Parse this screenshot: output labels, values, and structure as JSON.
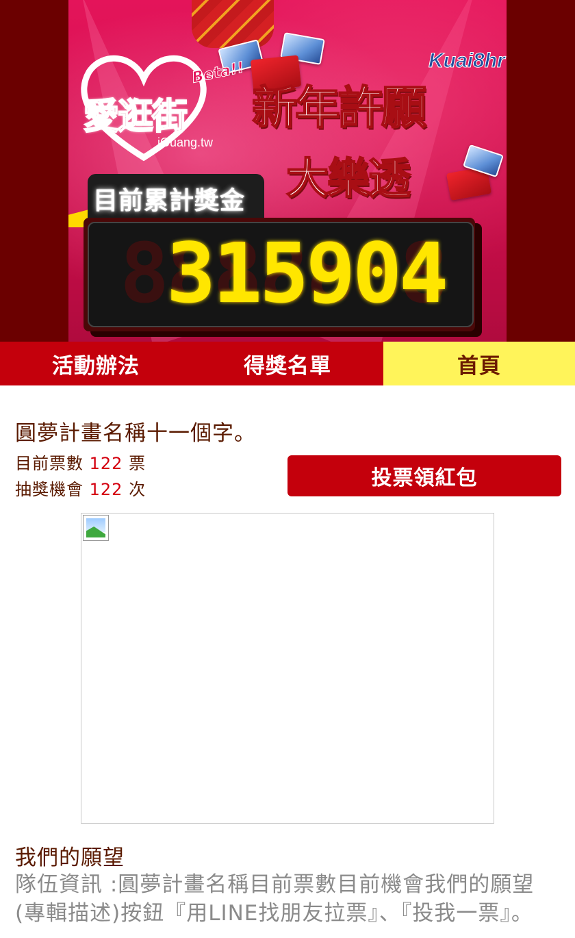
{
  "banner": {
    "logo_text": "愛逛街",
    "beta_label": "Beta!!",
    "site_url": "iGuang.tw",
    "headline_line1": "新年許願",
    "headline_line2": "大樂透",
    "partner_logo": "Kuai8hr",
    "prize_label": "目前累計獎金",
    "counter_digits": [
      "8",
      "3",
      "1",
      "5",
      "9",
      "0",
      "4"
    ],
    "counter_lit": [
      false,
      true,
      true,
      true,
      true,
      true,
      true
    ],
    "colors": {
      "banner_bg": "#e4145a",
      "outer_bg": "#6b0000",
      "digit_lit": "#ffe600"
    }
  },
  "nav": {
    "tabs": [
      {
        "label": "活動辦法",
        "active": false
      },
      {
        "label": "得獎名單",
        "active": false
      },
      {
        "label": "首頁",
        "active": true
      }
    ],
    "colors": {
      "tab_bg": "#c4000c",
      "active_bg": "#fff45a"
    }
  },
  "project": {
    "name": "圓夢計畫名稱十一個字。",
    "votes_label": "目前票數",
    "votes_value": "122",
    "votes_unit": "票",
    "chances_label": "抽獎機會",
    "chances_value": "122",
    "chances_unit": "次",
    "vote_button_label": "投票領紅包"
  },
  "image": {
    "icon": "broken-image-icon"
  },
  "wishes": {
    "heading": "我們的願望",
    "body": "隊伍資訊 :圓夢計畫名稱目前票數目前機會我們的願望 (專輯描述)按鈕『用LINE找朋友拉票』、『投我一票』。"
  }
}
